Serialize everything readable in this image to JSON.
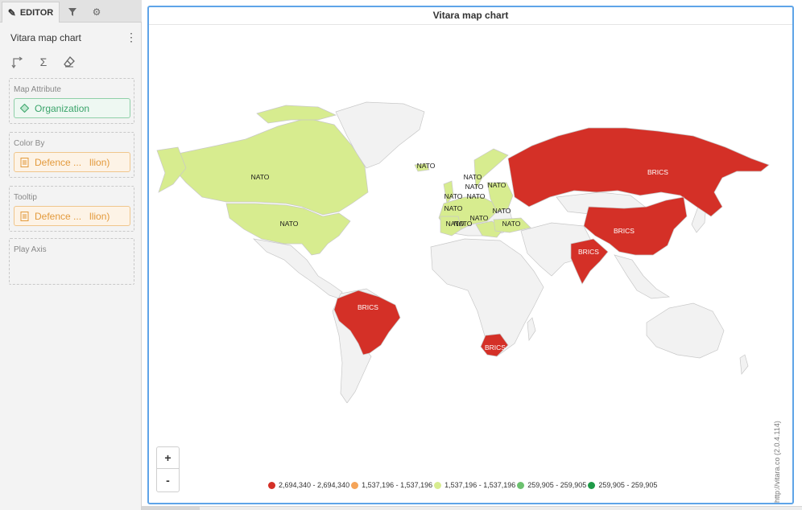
{
  "editor": {
    "tabs": [
      {
        "label": "EDITOR",
        "icon": "pencil-icon"
      },
      {
        "label": "",
        "icon": "filter-icon"
      },
      {
        "label": "",
        "icon": "gear-icon"
      }
    ],
    "chart_name": "Vitara map chart",
    "toolbar_icons": [
      "axis-swap-icon",
      "sigma-icon",
      "eraser-icon"
    ],
    "zones": {
      "map_attribute": {
        "title": "Map Attribute",
        "pill": "Organization"
      },
      "color_by": {
        "title": "Color By",
        "pill_left": "Defence ...",
        "pill_right": "llion)"
      },
      "tooltip": {
        "title": "Tooltip",
        "pill_left": "Defence ...",
        "pill_right": "llion)"
      },
      "play_axis": {
        "title": "Play Axis"
      }
    }
  },
  "chart": {
    "title": "Vitara map chart",
    "zoom_in": "+",
    "zoom_out": "-",
    "credits": "http://vitara.co (2.0.4.114)",
    "colors": {
      "brics": "#d43027",
      "nato": "#d7ec8f",
      "land": "#f2f2f2",
      "border": "#c8c8c8",
      "accent": "#5ea4e8"
    }
  },
  "chart_data": {
    "type": "map",
    "regions": [
      {
        "name": "NATO",
        "group": "NATO"
      },
      {
        "name": "BRICS",
        "group": "BRICS"
      }
    ],
    "labels": {
      "nato": "NATO",
      "brics": "BRICS"
    },
    "legend": [
      {
        "label": "2,694,340 - 2,694,340",
        "color": "#d43027"
      },
      {
        "label": "1,537,196 - 1,537,196",
        "color": "#f5a458"
      },
      {
        "label": "1,537,196 - 1,537,196",
        "color": "#d7ec8f"
      },
      {
        "label": "259,905 - 259,905",
        "color": "#6cc16f"
      },
      {
        "label": "259,905 - 259,905",
        "color": "#1f9a48"
      }
    ]
  }
}
